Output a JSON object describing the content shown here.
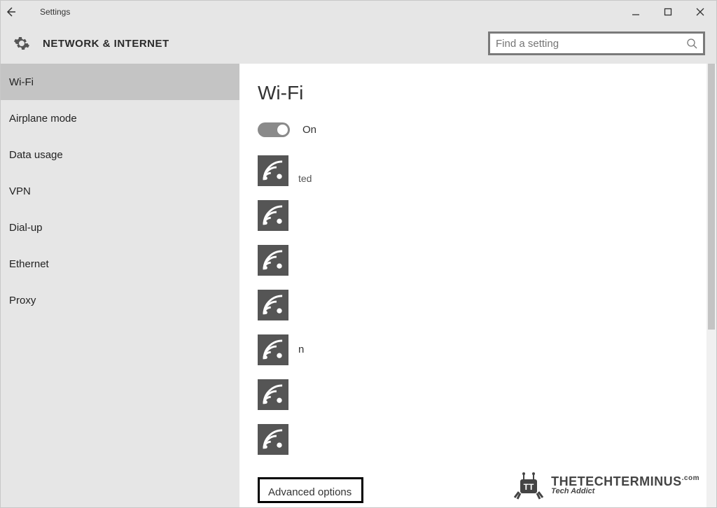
{
  "window": {
    "title": "Settings"
  },
  "header": {
    "category": "NETWORK & INTERNET",
    "search_placeholder": "Find a setting"
  },
  "sidebar": {
    "items": [
      {
        "label": "Wi-Fi",
        "selected": true
      },
      {
        "label": "Airplane mode",
        "selected": false
      },
      {
        "label": "Data usage",
        "selected": false
      },
      {
        "label": "VPN",
        "selected": false
      },
      {
        "label": "Dial-up",
        "selected": false
      },
      {
        "label": "Ethernet",
        "selected": false
      },
      {
        "label": "Proxy",
        "selected": false
      }
    ]
  },
  "main": {
    "heading": "Wi-Fi",
    "toggle_state": "On",
    "networks": [
      {
        "ssid_obscured": true,
        "status_fragment": "ted"
      },
      {
        "ssid_obscured": true,
        "status_fragment": ""
      },
      {
        "ssid_obscured": true,
        "status_fragment": ""
      },
      {
        "ssid_obscured": true,
        "status_fragment": ""
      },
      {
        "ssid_obscured": true,
        "status_fragment": "n"
      },
      {
        "ssid_obscured": true,
        "status_fragment": ""
      },
      {
        "ssid_obscured": true,
        "status_fragment": ""
      }
    ],
    "advanced_label": "Advanced options"
  },
  "watermark": {
    "brand": "THETECHTERMINUS",
    "tagline": "Tech Addict",
    "suffix": ".com"
  }
}
